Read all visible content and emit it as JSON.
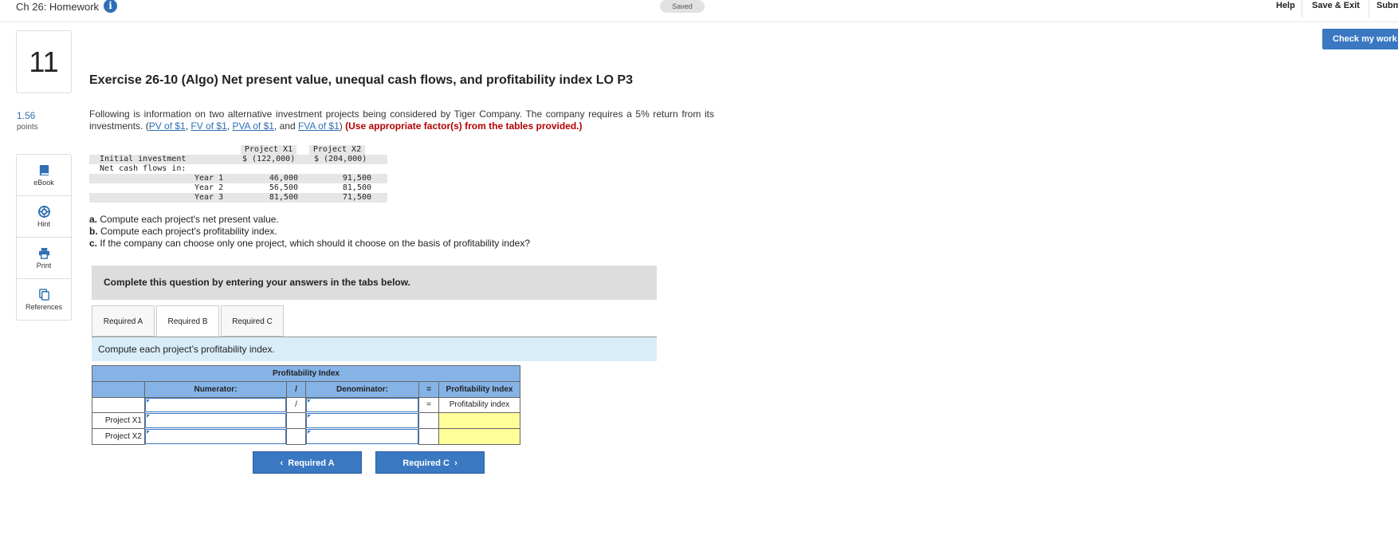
{
  "header": {
    "chapter_title": "Ch 26: Homework",
    "saved_label": "Saved",
    "help_label": "Help",
    "save_exit_label": "Save & Exit",
    "submit_label": "Subm",
    "check_work_label": "Check my work"
  },
  "question": {
    "number": "11",
    "points_value": "1.56",
    "points_label": "points"
  },
  "sidebar": {
    "items": [
      {
        "label": "eBook",
        "icon": "book-icon"
      },
      {
        "label": "Hint",
        "icon": "lifebuoy-icon"
      },
      {
        "label": "Print",
        "icon": "printer-icon"
      },
      {
        "label": "References",
        "icon": "copy-icon"
      }
    ]
  },
  "exercise": {
    "title": "Exercise 26-10 (Algo) Net present value, unequal cash flows, and profitability index LO P3",
    "intro_text": "Following is information on two alternative investment projects being considered by Tiger Company. The company requires a 5% return from its investments. (",
    "links": [
      "PV of $1",
      "FV of $1",
      "PVA of $1",
      "FVA of $1"
    ],
    "sep1": ", ",
    "sep2": ", ",
    "sep3": ", and ",
    "close_paren": ") ",
    "red_note": "(Use appropriate factor(s) from the tables provided.)"
  },
  "data_table": {
    "headers": [
      "Project X1",
      "Project X2"
    ],
    "initial_label": "Initial investment",
    "initial_values": [
      "$ (122,000)",
      "$ (204,000)"
    ],
    "net_cash_label": "Net cash flows in:",
    "years": [
      {
        "label": "Year 1",
        "x1": "46,000",
        "x2": "91,500"
      },
      {
        "label": "Year 2",
        "x1": "56,500",
        "x2": "81,500"
      },
      {
        "label": "Year 3",
        "x1": "81,500",
        "x2": "71,500"
      }
    ]
  },
  "questions": [
    {
      "letter": "a.",
      "text": " Compute each project's net present value."
    },
    {
      "letter": "b.",
      "text": " Compute each project's profitability index."
    },
    {
      "letter": "c.",
      "text": " If the company can choose only one project, which should it choose on the basis of profitability index?"
    }
  ],
  "complete_box": "Complete this question by entering your answers in the tabs below.",
  "tabs": [
    "Required A",
    "Required B",
    "Required C"
  ],
  "active_tab": "Required B",
  "instruction": "Compute each project’s profitability index.",
  "pi_table": {
    "title": "Profitability Index",
    "col_numerator": "Numerator:",
    "col_slash": "/",
    "col_denominator": "Denominator:",
    "col_equals": "=",
    "col_result": "Profitability Index",
    "sub_slash": "/",
    "sub_equals": "=",
    "sub_result": "Profitability index",
    "rows": [
      "Project X1",
      "Project X2"
    ]
  },
  "nav": {
    "prev_label": "Required A",
    "next_label": "Required C"
  },
  "colors": {
    "accent_blue": "#3a78c2",
    "header_blue": "#85b3e6",
    "instruction_bg": "#d9edf9",
    "result_yellow": "#ffff99",
    "note_red": "#b30000"
  }
}
